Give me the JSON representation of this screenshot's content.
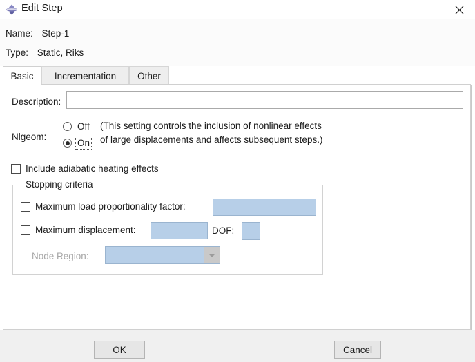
{
  "window": {
    "title": "Edit Step",
    "icon": "abaqus-diamond-icon",
    "close_icon": "close-icon"
  },
  "header": {
    "name_label": "Name:",
    "name_value": "Step-1",
    "type_label": "Type:",
    "type_value": "Static, Riks"
  },
  "tabs": [
    {
      "label": "Basic",
      "selected": true
    },
    {
      "label": "Incrementation",
      "selected": false
    },
    {
      "label": "Other",
      "selected": false
    }
  ],
  "basic": {
    "description_label": "Description:",
    "description_value": "",
    "description_placeholder": "",
    "nlgeom_label": "Nlgeom:",
    "nlgeom_off_label": "Off",
    "nlgeom_on_label": "On",
    "nlgeom_selected": "On",
    "nlgeom_note": "(This setting controls the inclusion of nonlinear effects\nof large displacements and affects subsequent steps.)",
    "adiabatic_label": "Include adiabatic heating effects",
    "adiabatic_checked": false
  },
  "stopping_criteria": {
    "group_title": "Stopping criteria",
    "max_load_label": "Maximum load proportionality factor:",
    "max_load_checked": false,
    "max_load_value": "",
    "max_disp_label": "Maximum displacement:",
    "max_disp_checked": false,
    "max_disp_value": "",
    "dof_label": "DOF:",
    "dof_value": "",
    "node_region_label": "Node Region:",
    "node_region_value": "",
    "node_region_options": [],
    "caret_icon": "chevron-down-icon"
  },
  "footer": {
    "ok_label": "OK",
    "cancel_label": "Cancel"
  },
  "colors": {
    "disabled_field_bg": "#b7cfe8",
    "panel_bg": "#ffffff",
    "footer_bg": "#f0f0f0",
    "tab_inactive_bg": "#eeeeee",
    "icon_purple": "#6d6dae"
  }
}
